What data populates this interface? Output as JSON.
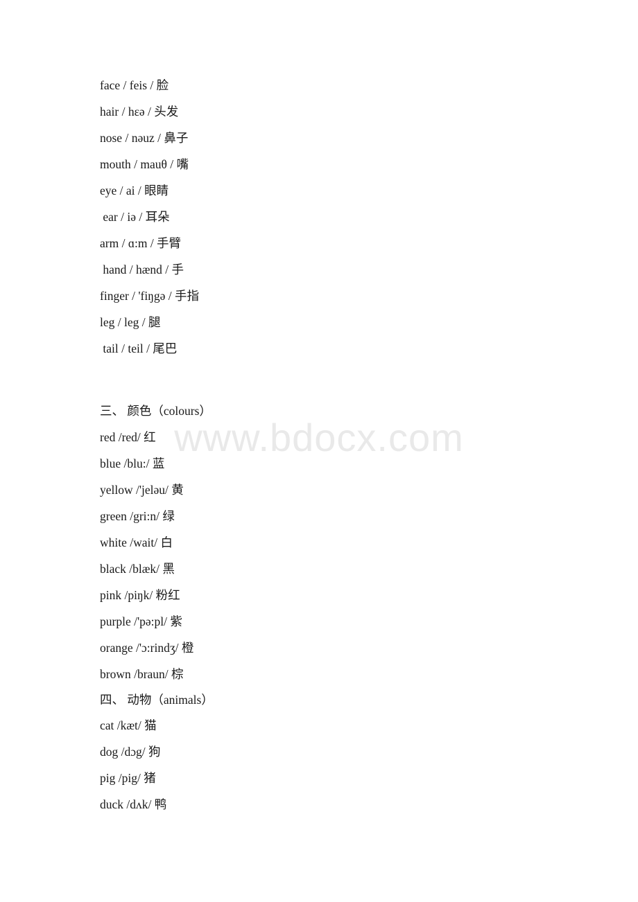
{
  "document": {
    "watermark": "www.bdocx.com",
    "sections": [
      {
        "id": "body-parts",
        "heading": null,
        "entries": [
          "face / feis / 脸",
          "hair / hɛə / 头发",
          "nose / nəuz / 鼻子",
          "mouth / mauθ / 嘴",
          "eye / ai / 眼睛",
          " ear / iə / 耳朵",
          "arm / ɑ:m / 手臂",
          " hand / hænd / 手",
          "finger / 'fiŋgə / 手指",
          "leg / leg / 腿",
          " tail / teil / 尾巴"
        ]
      },
      {
        "id": "colours",
        "heading": "三、 颜色（colours）",
        "entries": [
          "red /red/ 红",
          "blue /blu:/ 蓝",
          "yellow /'jeləu/ 黄",
          "green /gri:n/ 绿",
          "white /wait/ 白",
          "black /blæk/ 黑",
          "pink /piŋk/ 粉红",
          "purple /'pə:pl/ 紫",
          "orange /'ɔ:rindʒ/ 橙",
          "brown /braun/ 棕"
        ]
      },
      {
        "id": "animals",
        "heading": "四、 动物（animals）",
        "entries": [
          "cat /kæt/ 猫",
          "dog /dɔg/ 狗",
          "pig /pig/ 猪",
          "duck /dʌk/ 鸭"
        ]
      }
    ]
  }
}
